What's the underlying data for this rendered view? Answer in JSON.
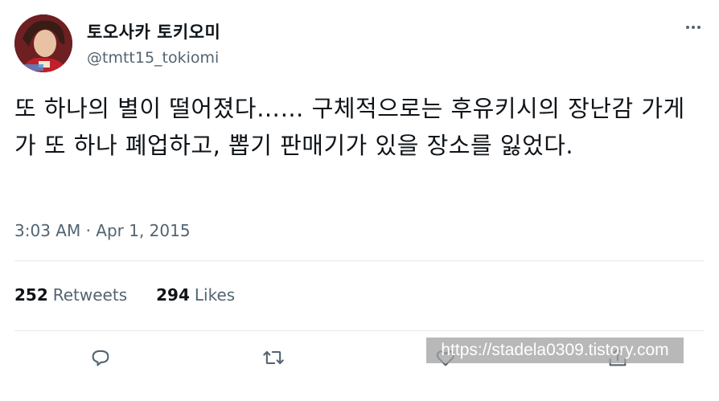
{
  "author": {
    "display_name": "토오사카 토키오미",
    "handle": "@tmtt15_tokiomi",
    "avatar_icon": "profile-avatar"
  },
  "tweet": {
    "text": "또 하나의 별이 떨어졌다…… 구체적으로는 후유키시의 장난감 가게가 또 하나 폐업하고, 뽑기 판매기가 있을 장소를 잃었다.",
    "timestamp": "3:03 AM · Apr 1, 2015"
  },
  "stats": {
    "retweets_count": "252",
    "retweets_label": "Retweets",
    "likes_count": "294",
    "likes_label": "Likes"
  },
  "actions": {
    "reply_icon": "reply-icon",
    "retweet_icon": "retweet-icon",
    "like_icon": "like-icon",
    "share_icon": "share-icon",
    "more_icon": "more-options-icon"
  },
  "watermark": {
    "text": "https://stadela0309.tistory.com"
  },
  "colors": {
    "text_primary": "#0f1419",
    "text_secondary": "#536471",
    "divider": "#e7e9ea",
    "icon": "#536471"
  }
}
